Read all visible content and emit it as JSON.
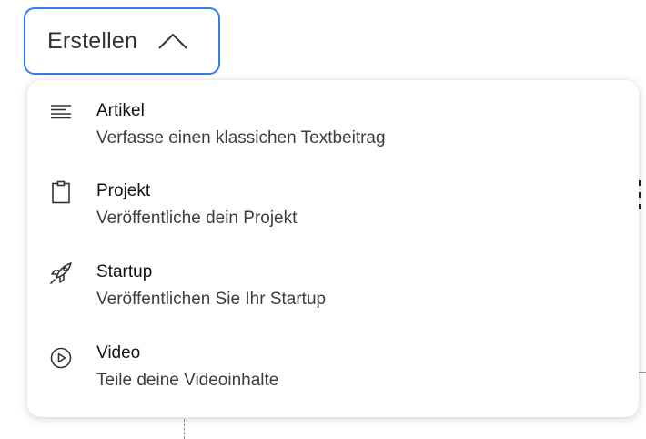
{
  "create_button": {
    "label": "Erstellen",
    "icon": "chevron-up-icon",
    "accent_color": "#2f80ed"
  },
  "menu": {
    "items": [
      {
        "icon": "text-lines-icon",
        "title": "Artikel",
        "description": "Verfasse einen klassichen Textbeitrag"
      },
      {
        "icon": "clipboard-icon",
        "title": "Projekt",
        "description": "Veröffentliche dein Projekt"
      },
      {
        "icon": "rocket-icon",
        "title": "Startup",
        "description": "Veröffentlichen Sie Ihr Startup"
      },
      {
        "icon": "play-circle-icon",
        "title": "Video",
        "description": "Teile deine Videoinhalte"
      }
    ]
  }
}
